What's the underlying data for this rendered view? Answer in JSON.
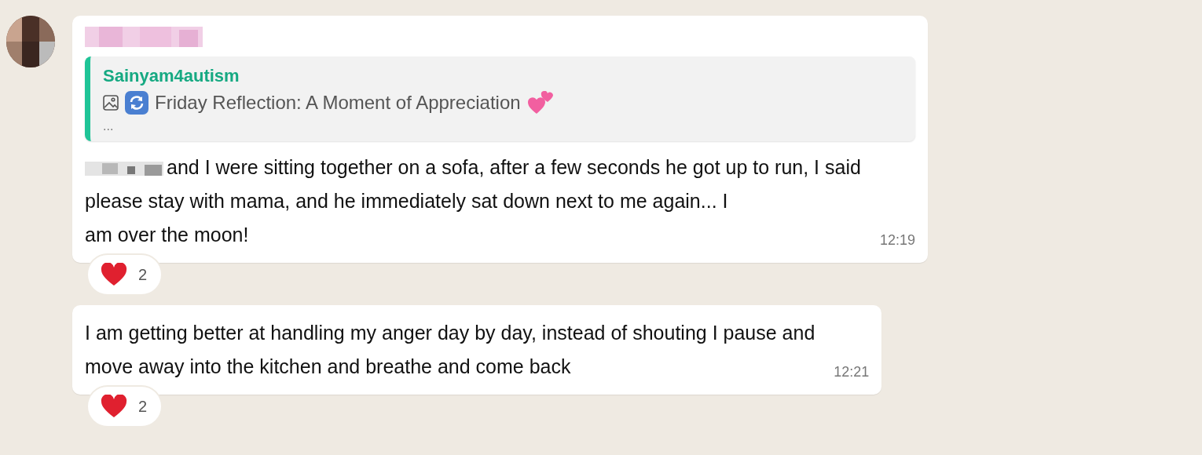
{
  "messages": [
    {
      "kind": "quoted",
      "quote": {
        "author": "Sainyam4autism",
        "text": "Friday Reflection: A Moment of Appreciation",
        "more": "..."
      },
      "text": "and I were sitting together on a sofa, after a few seconds he got up to run, I said\nplease stay with mama, and he immediately sat down next to me again... I\nam over the moon!",
      "time": "12:19",
      "reaction_count": "2"
    },
    {
      "kind": "plain",
      "text": "I am getting better at handling my anger day by day, instead of shouting I pause and\nmove away into the kitchen and breathe and come back",
      "time": "12:21",
      "reaction_count": "2"
    }
  ]
}
